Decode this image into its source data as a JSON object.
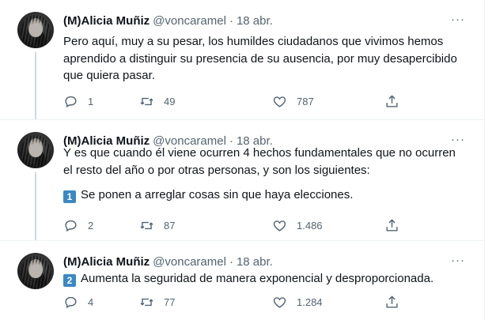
{
  "tweets": [
    {
      "display_name": "(M)Alicia Muñiz",
      "handle": "@voncaramel",
      "separator": "·",
      "date": "18 abr.",
      "more": "···",
      "paragraphs": [
        "Pero aquí, muy a su pesar, los humildes ciudadanos que vivimos hemos aprendido a distinguir su presencia de su ausencia, por muy desapercibido que quiera pasar."
      ],
      "replies": "1",
      "retweets": "49",
      "likes": "787"
    },
    {
      "display_name": "(M)Alicia Muñiz",
      "handle": "@voncaramel",
      "separator": "·",
      "date": "18 abr.",
      "more": "···",
      "paragraphs": [
        "Y es que cuando él viene ocurren 4 hechos fundamentales que no ocurren el resto del año o por otras personas, y son los siguientes:"
      ],
      "keycap": "1",
      "keycap_text": "Se ponen a arreglar cosas sin que haya elecciones.",
      "replies": "2",
      "retweets": "87",
      "likes": "1.486"
    },
    {
      "display_name": "(M)Alicia Muñiz",
      "handle": "@voncaramel",
      "separator": "·",
      "date": "18 abr.",
      "more": "···",
      "keycap": "2",
      "keycap_text": "Aumenta la seguridad de manera exponencial y desproporcionada.",
      "replies": "4",
      "retweets": "77",
      "likes": "1.284"
    }
  ],
  "icons": {
    "reply": "reply-icon",
    "retweet": "retweet-icon",
    "like": "heart-icon",
    "share": "share-icon",
    "more": "more-icon"
  },
  "colors": {
    "text": "#0f1419",
    "secondary": "#536471",
    "keycap": "#3b88c3",
    "divider": "#eff3f4",
    "thread": "#cfd9de"
  }
}
